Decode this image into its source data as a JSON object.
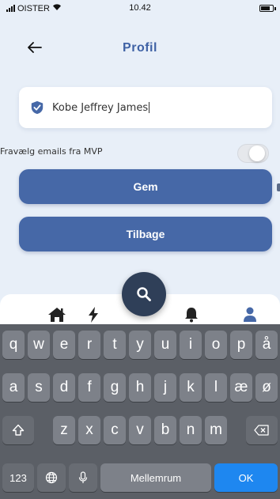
{
  "status_bar": {
    "carrier": "OISTER",
    "time": "10.42"
  },
  "header": {
    "title": "Profil",
    "back_icon": "arrow-left-icon"
  },
  "form": {
    "name_value": "Kobe Jeffrey James",
    "name_icon": "shield-check-icon",
    "optout_label": "Fravælg emails fra MVP",
    "optout_enabled": false
  },
  "buttons": {
    "save_label": "Gem",
    "back_label": "Tilbage"
  },
  "bottom_nav": {
    "items": [
      "home-icon",
      "bolt-icon",
      "search-icon",
      "bell-icon",
      "user-icon"
    ]
  },
  "keyboard": {
    "row1": [
      "q",
      "w",
      "e",
      "r",
      "t",
      "y",
      "u",
      "i",
      "o",
      "p",
      "å"
    ],
    "row2": [
      "a",
      "s",
      "d",
      "f",
      "g",
      "h",
      "j",
      "k",
      "l",
      "æ",
      "ø"
    ],
    "row3": [
      "z",
      "x",
      "c",
      "v",
      "b",
      "n",
      "m"
    ],
    "numbers_label": "123",
    "space_label": "Mellemrum",
    "ok_label": "OK"
  },
  "colors": {
    "accent": "#4668a7",
    "title": "#3f62a5",
    "fab": "#2f3f58",
    "ok_key": "#1e87f0"
  }
}
